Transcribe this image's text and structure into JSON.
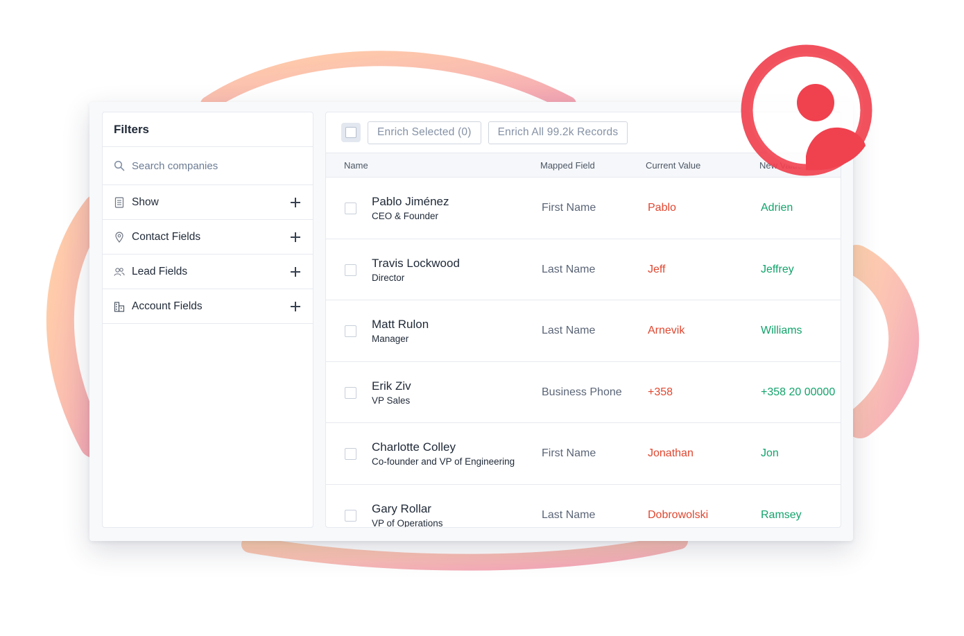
{
  "colors": {
    "current_value": "#e0462f",
    "new_value": "#12a36b",
    "brand_red": "#f0414f",
    "blob_orange": "#ffc49e",
    "blob_pink": "#f3a0b0"
  },
  "sidebar": {
    "title": "Filters",
    "search_placeholder": "Search companies",
    "search_icon": "search-icon",
    "items": [
      {
        "label": "Show",
        "icon": "list-icon"
      },
      {
        "label": "Contact Fields",
        "icon": "location-pin-icon"
      },
      {
        "label": "Lead Fields",
        "icon": "users-icon"
      },
      {
        "label": "Account Fields",
        "icon": "building-icon"
      }
    ]
  },
  "toolbar": {
    "enrich_selected": "Enrich Selected (0)",
    "enrich_all": "Enrich All 99.2k Records"
  },
  "table": {
    "columns": [
      "Name",
      "Mapped Field",
      "Current Value",
      "New Value"
    ],
    "rows": [
      {
        "name": "Pablo Jiménez",
        "title": "CEO & Founder",
        "mapped": "First Name",
        "current": "Pablo",
        "new": "Adrien"
      },
      {
        "name": "Travis Lockwood",
        "title": "Director",
        "mapped": "Last Name",
        "current": "Jeff",
        "new": "Jeffrey"
      },
      {
        "name": "Matt Rulon",
        "title": "Manager",
        "mapped": "Last Name",
        "current": "Arnevik",
        "new": "Williams"
      },
      {
        "name": "Erik Ziv",
        "title": "VP Sales",
        "mapped": "Business Phone",
        "current": "+358",
        "new": "+358 20 00000"
      },
      {
        "name": "Charlotte Colley",
        "title": "Co-founder and VP of Engineering",
        "mapped": "First Name",
        "current": "Jonathan",
        "new": "Jon"
      },
      {
        "name": "Gary Rollar",
        "title": "VP of Operations",
        "mapped": "Last Name",
        "current": "Dobrowolski",
        "new": "Ramsey"
      }
    ]
  }
}
